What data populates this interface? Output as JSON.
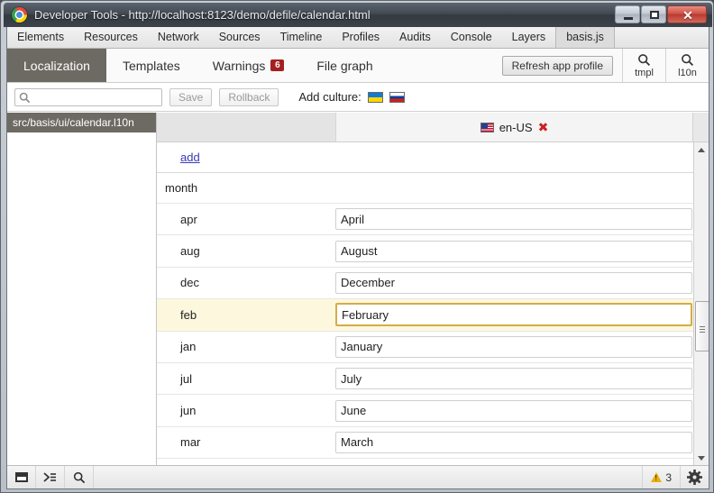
{
  "window": {
    "title": "Developer Tools - http://localhost:8123/demo/defile/calendar.html",
    "logo_icon": "chrome-logo-icon",
    "minimize_label": "—",
    "maximize_label": "□",
    "close_label": "✕"
  },
  "panel_tabs": [
    {
      "label": "Elements",
      "selected": false
    },
    {
      "label": "Resources",
      "selected": false
    },
    {
      "label": "Network",
      "selected": false
    },
    {
      "label": "Sources",
      "selected": false
    },
    {
      "label": "Timeline",
      "selected": false
    },
    {
      "label": "Profiles",
      "selected": false
    },
    {
      "label": "Audits",
      "selected": false
    },
    {
      "label": "Console",
      "selected": false
    },
    {
      "label": "Layers",
      "selected": false
    },
    {
      "label": "basis.js",
      "selected": true
    }
  ],
  "sub_toolbar": {
    "tabs": [
      {
        "label": "Localization",
        "badge": "",
        "selected": true
      },
      {
        "label": "Templates",
        "badge": "",
        "selected": false
      },
      {
        "label": "Warnings",
        "badge": "6",
        "selected": false
      },
      {
        "label": "File graph",
        "badge": "",
        "selected": false
      }
    ],
    "refresh_label": "Refresh app profile",
    "tools": [
      {
        "icon": "search-icon",
        "label": "tmpl"
      },
      {
        "icon": "search-icon",
        "label": "l10n"
      }
    ]
  },
  "search": {
    "value": "",
    "placeholder": "",
    "icon": "search-icon"
  },
  "actions": {
    "save_label": "Save",
    "rollback_label": "Rollback",
    "save_enabled": false,
    "rollback_enabled": false
  },
  "add_culture": {
    "label": "Add culture:",
    "cultures": [
      {
        "code": "uk-UA",
        "icon": "flag-ua-icon"
      },
      {
        "code": "ru-RU",
        "icon": "flag-ru-icon"
      }
    ]
  },
  "sidebar": {
    "items": [
      {
        "label": "src/basis/ui/calendar.l10n",
        "selected": true
      }
    ]
  },
  "culture_column": {
    "flag_icon": "flag-us-icon",
    "name": "en-US",
    "delete_icon": "delete-x-icon",
    "delete_label": "✖"
  },
  "table": {
    "add_link": "add",
    "group_label": "month",
    "rows": [
      {
        "key": "apr",
        "value": "April",
        "highlighted": false
      },
      {
        "key": "aug",
        "value": "August",
        "highlighted": false
      },
      {
        "key": "dec",
        "value": "December",
        "highlighted": false
      },
      {
        "key": "feb",
        "value": "February",
        "highlighted": true
      },
      {
        "key": "jan",
        "value": "January",
        "highlighted": false
      },
      {
        "key": "jul",
        "value": "July",
        "highlighted": false
      },
      {
        "key": "jun",
        "value": "June",
        "highlighted": false
      },
      {
        "key": "mar",
        "value": "March",
        "highlighted": false
      }
    ]
  },
  "scrollbar": {
    "up_icon": "chevron-up-icon",
    "down_icon": "chevron-down-icon",
    "thumb_icon": "scroll-thumb-grip-icon"
  },
  "statusbar": {
    "left_buttons": [
      {
        "icon": "dock-panel-icon"
      },
      {
        "icon": "console-prompt-icon"
      },
      {
        "icon": "search-icon"
      }
    ],
    "warning_icon": "warning-triangle-icon",
    "warning_count": "3",
    "settings_icon": "gear-icon"
  },
  "colors": {
    "accent_selected": "#6d6a63",
    "badge_red": "#a32020",
    "link": "#3a3ab5",
    "highlight_row": "#fdf8dd",
    "focus_border": "#d4ac4a",
    "warning_yellow": "#e7b10a"
  }
}
